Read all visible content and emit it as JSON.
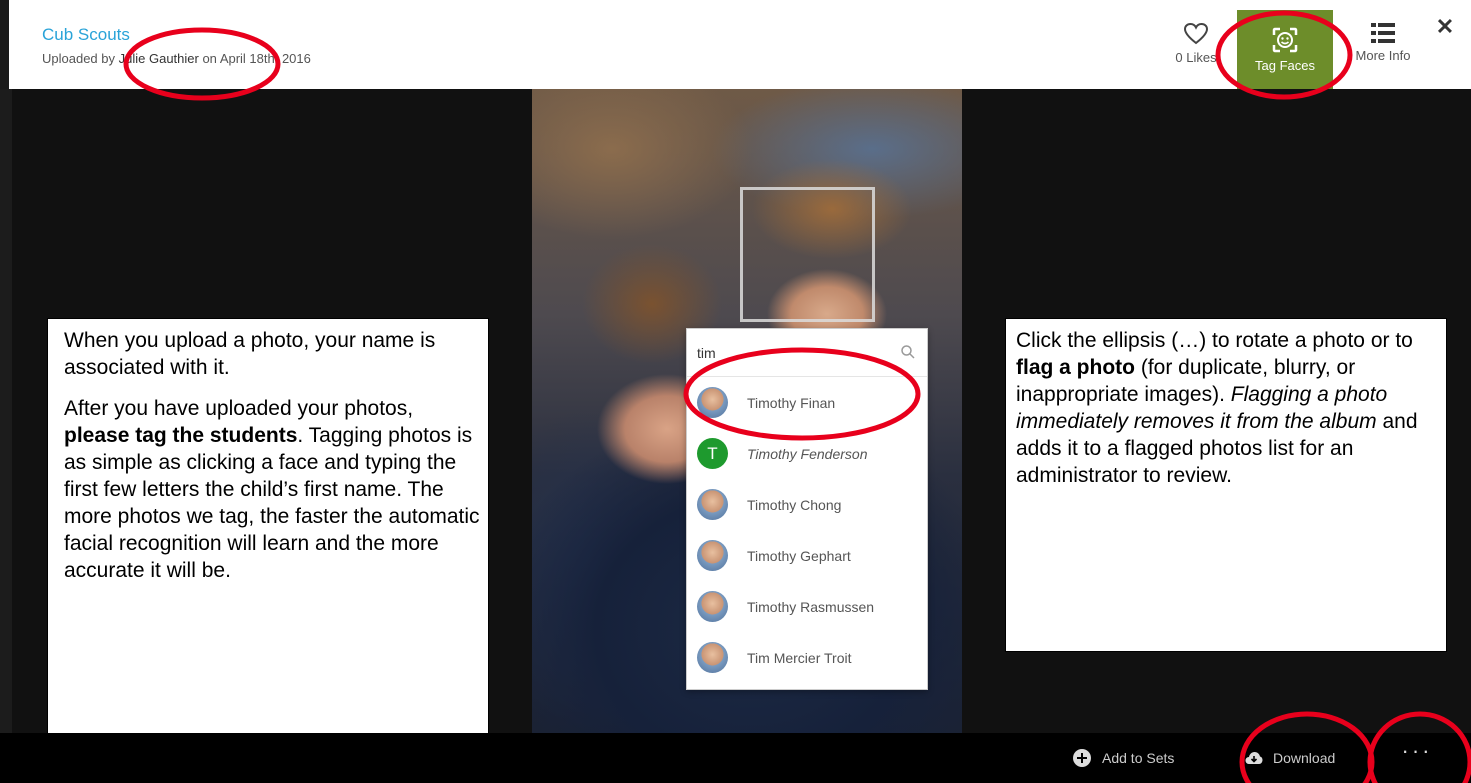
{
  "header": {
    "album_title": "Cub Scouts",
    "uploaded_prefix": "Uploaded by ",
    "uploader": "Julie Gauthier",
    "uploaded_mid": " on ",
    "upload_date": "April 18th, 2016",
    "likes_label": "0 Likes",
    "tag_faces_label": "Tag Faces",
    "more_info_label": "More Info",
    "close_glyph": "✕",
    "tag_faces_color": "#6d8d2a",
    "title_color": "#29a3d8"
  },
  "tagger": {
    "search_value": "tim",
    "results": [
      {
        "name": "Timothy Finan",
        "avatar": "photo",
        "italic": false
      },
      {
        "name": "Timothy Fenderson",
        "avatar": "letter",
        "initial": "T",
        "italic": true
      },
      {
        "name": "Timothy Chong",
        "avatar": "photo",
        "italic": false
      },
      {
        "name": "Timothy Gephart",
        "avatar": "photo",
        "italic": false
      },
      {
        "name": "Timothy Rasmussen",
        "avatar": "photo",
        "italic": false
      },
      {
        "name": "Tim Mercier Troit",
        "avatar": "photo",
        "italic": false
      }
    ]
  },
  "callouts": {
    "left": {
      "p1": "When you upload a photo, your name is associated with it.",
      "p2_a": "After you have uploaded your photos, ",
      "p2_bold": "please tag the students",
      "p2_b": ". Tagging photos is as simple as clicking a face and typing the first few letters the child’s first name. The more photos we tag, the faster the automatic facial recognition will learn and the more accurate it will be."
    },
    "right": {
      "a": "Click the ellipsis (…) to rotate a photo or to ",
      "bold": "flag a photo",
      "b": " (for duplicate, blurry, or inappropriate images). ",
      "italic": "Flagging a photo immediately removes it from the album",
      "c": " and adds it to a flagged photos list for an administrator to review."
    }
  },
  "footer": {
    "add_to_sets_label": "Add to Sets",
    "download_label": "Download",
    "ellipsis_label": "···"
  },
  "annotation_color": "#e8001c",
  "icons": [
    "heart-icon",
    "face-scan-icon",
    "list-icon",
    "close-icon",
    "search-icon",
    "plus-circle-icon",
    "download-cloud-icon",
    "ellipsis-icon"
  ]
}
